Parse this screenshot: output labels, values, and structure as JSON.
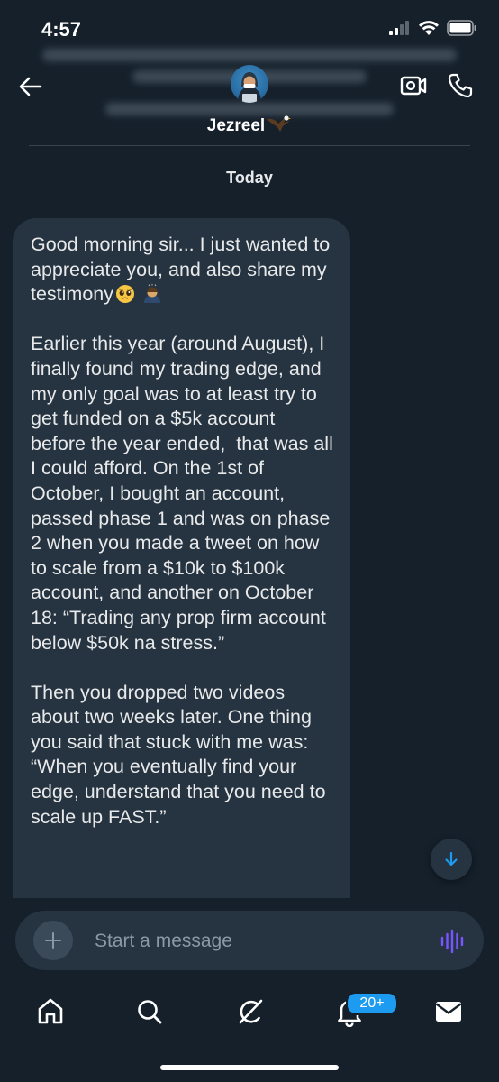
{
  "status_bar": {
    "time": "4:57"
  },
  "conversation": {
    "contact_name": "Jezreel",
    "day_label": "Today"
  },
  "message": {
    "text": "Good morning sir... I just wanted to appreciate you, and also share my testimony\n\nEarlier this year (around August), I finally found my trading edge, and my only goal was to at least try to get funded on a $5k account before the year ended,  that was all I could afford. On the 1st of October, I bought an account, passed phase 1 and was on phase 2 when you made a tweet on how to scale from a $10k to $100k account, and another on October 18: “Trading any prop firm account below $50k na stress.”\n\nThen you dropped two videos about two weeks later. One thing you said that stuck with me was: “When you eventually find your edge, understand that you need to scale up FAST.”",
    "emojis": [
      "pleading-face",
      "person-bowing"
    ]
  },
  "composer": {
    "placeholder": "Start a message"
  },
  "tabbar": {
    "notifications_badge": "20+"
  },
  "colors": {
    "background": "#15202b",
    "bubble": "#263340",
    "accent": "#1d9bf0",
    "voice_icon": "#7856ff"
  },
  "icons": {
    "back": "arrow-left-icon",
    "video": "video-call-icon",
    "phone": "phone-icon",
    "add": "plus-icon",
    "voice": "voice-waveform-icon",
    "scroll": "arrow-down-icon",
    "tabs": [
      "home-icon",
      "search-icon",
      "grok-icon",
      "bell-icon",
      "mail-icon"
    ]
  }
}
